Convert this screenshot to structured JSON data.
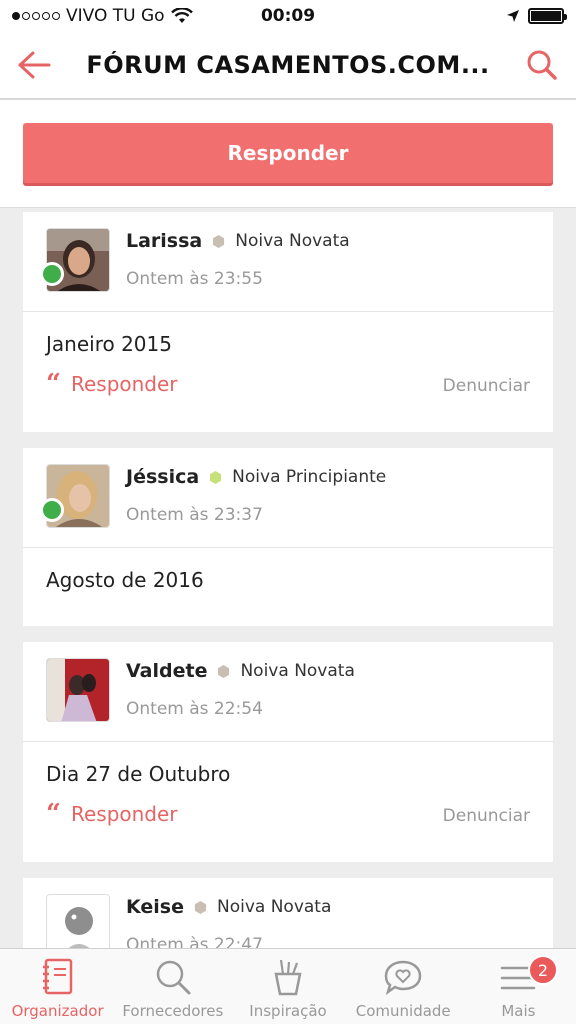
{
  "status_bar": {
    "carrier": "VIVO TU Go",
    "time": "00:09"
  },
  "nav": {
    "title": "FÓRUM CASAMENTOS.COM...",
    "back_icon": "arrow-left-icon",
    "search_icon": "search-icon"
  },
  "colors": {
    "accent": "#f26f6f",
    "online": "#3fae49",
    "badge_novata": "#c8bfb2",
    "badge_principiante": "#c6e07a"
  },
  "reply_button_label": "Responder",
  "posts": [
    {
      "author": "Larissa",
      "rank": "Noiva Novata",
      "rank_badge": "hex-beige",
      "time": "Ontem às 23:55",
      "body": "Janeiro 2015",
      "online": true,
      "reply_label": "Responder",
      "report_label": "Denunciar"
    },
    {
      "author": "Jéssica",
      "rank": "Noiva Principiante",
      "rank_badge": "hex-green",
      "time": "Ontem às 23:37",
      "body": "Agosto de 2016",
      "online": true
    },
    {
      "author": "Valdete",
      "rank": "Noiva Novata",
      "rank_badge": "hex-beige",
      "time": "Ontem às 22:54",
      "body": "Dia 27 de Outubro",
      "online": false,
      "reply_label": "Responder",
      "report_label": "Denunciar"
    },
    {
      "author": "Keise",
      "rank": "Noiva Novata",
      "rank_badge": "hex-beige",
      "time": "Ontem às 22:47",
      "online": false
    }
  ],
  "tabbar": {
    "tabs": [
      {
        "label": "Organizador",
        "icon": "notebook-icon",
        "active": true
      },
      {
        "label": "Fornecedores",
        "icon": "search-icon",
        "active": false
      },
      {
        "label": "Inspiração",
        "icon": "pencil-cup-icon",
        "active": false
      },
      {
        "label": "Comunidade",
        "icon": "chat-heart-icon",
        "active": false
      },
      {
        "label": "Mais",
        "icon": "menu-icon",
        "active": false,
        "badge": "2"
      }
    ]
  }
}
